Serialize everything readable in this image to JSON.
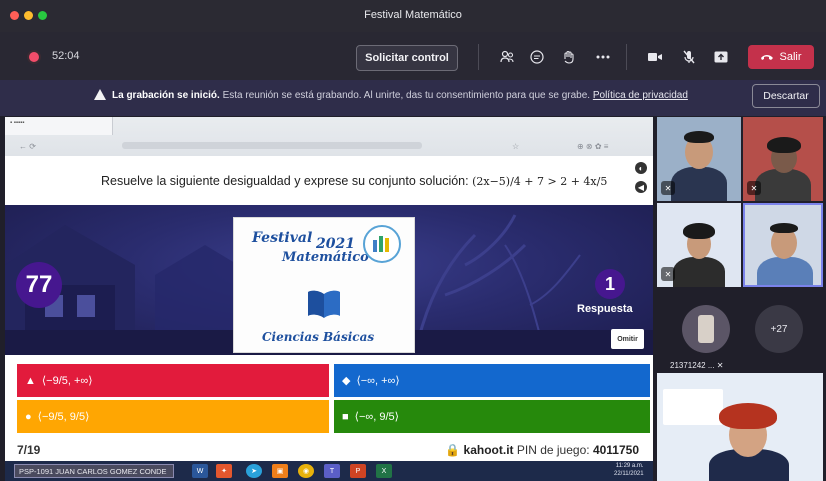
{
  "window": {
    "title": "Festival Matemático"
  },
  "toolbar": {
    "timer": "52:04",
    "request_control": "Solicitar control",
    "leave": "Salir",
    "icons": [
      "participants-icon",
      "chat-icon",
      "reactions-icon",
      "more-icon",
      "camera-icon",
      "mic-off-icon",
      "share-icon",
      "phone-icon"
    ]
  },
  "banner": {
    "title": "La grabación se inició.",
    "message": "Esta reunión se está grabando. Al unirte, das tu consentimiento para que se grabe.",
    "link": "Política de privacidad",
    "dismiss": "Descartar"
  },
  "share": {
    "question_prefix": "Resuelve la siguiente desigualdad y exprese su conjunto solución:",
    "question_math": "(2x−5)/4 + 7 > 2 + 4x/5",
    "timer": "77",
    "answers_count": "1",
    "answers_label": "Respuesta",
    "skip": "Omitir",
    "poster": {
      "line1": "Festival",
      "year": "2021",
      "line2": "Matemático",
      "line3": "Ciencias  Básicas"
    },
    "answers": [
      {
        "shape": "▲",
        "text": "⟨−9/5, +∞⟩"
      },
      {
        "shape": "◆",
        "text": "⟨−∞, +∞⟩"
      },
      {
        "shape": "●",
        "text": "⟨−9/5, 9/5⟩"
      },
      {
        "shape": "■",
        "text": "⟨−∞, 9/5⟩"
      }
    ],
    "progress": "7/19",
    "site": "kahoot.it",
    "pin_label": "PIN de juego:",
    "pin": "4011750"
  },
  "taskbar": {
    "user": "PSP-1091 JUAN CARLOS GOMEZ CONDE",
    "time": "11:29 a.m.",
    "date": "22/11/2021"
  },
  "participants": {
    "avatar_name": "21371242 ...",
    "more": "+27"
  },
  "colors": {
    "answer_red": "#e21b3c",
    "answer_blue": "#1368ce",
    "answer_yellow": "#ffa602",
    "answer_green": "#26890c",
    "kahoot_purple": "#46178f",
    "leave_red": "#c4314b"
  }
}
